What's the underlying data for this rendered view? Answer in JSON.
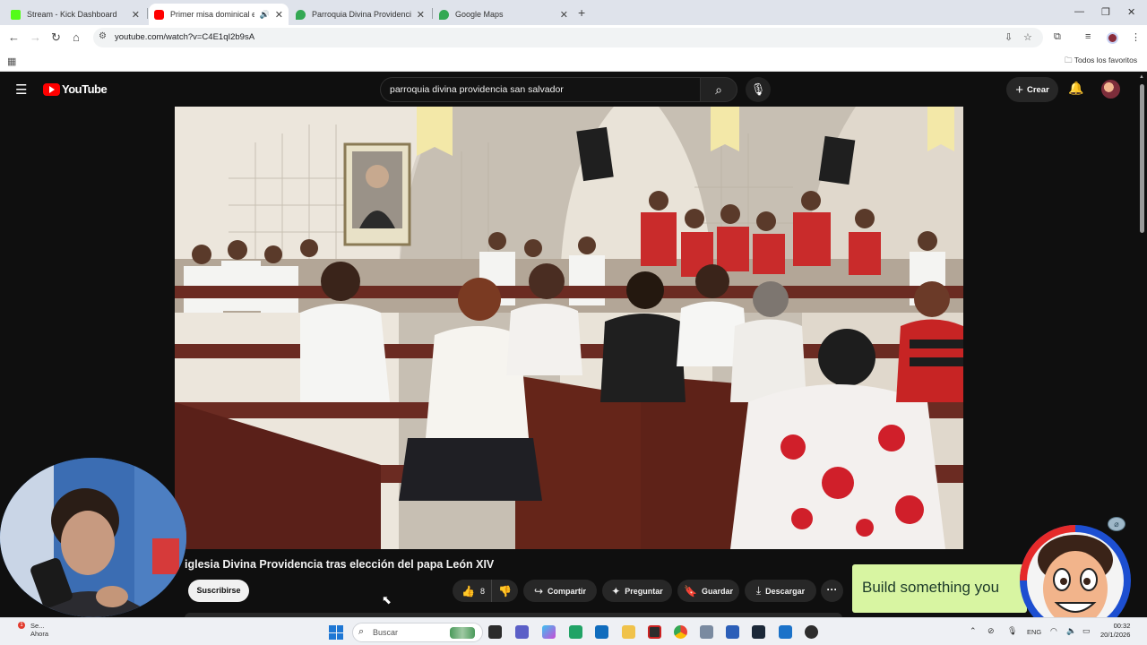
{
  "browser": {
    "tabs": [
      {
        "title": "Stream - Kick Dashboard",
        "favicon_color": "#53fc18"
      },
      {
        "title": "Primer misa dominical en iglesia Divina Providencia",
        "favicon_color": "#ff0000"
      },
      {
        "title": "Parroquia Divina Providencia - Google Maps",
        "favicon_color": "#34a853"
      },
      {
        "title": "Google Maps",
        "favicon_color": "#34a853"
      }
    ],
    "url": "youtube.com/watch?v=C4E1qI2b9sA",
    "bookmarks_all_label": "Todos los favoritos"
  },
  "youtube": {
    "logo_text": "YouTube",
    "search_query": "parroquia divina providencia san salvador",
    "create_label": "Crear"
  },
  "video": {
    "title": "iglesia Divina Providencia tras elección del papa León XIV",
    "subscribe_label": "Suscribirse",
    "like_count": "8",
    "actions": {
      "share": "Compartir",
      "ask": "Preguntar",
      "save": "Guardar",
      "download": "Descargar"
    }
  },
  "ad": {
    "text": "Build something you"
  },
  "taskbar": {
    "weather_line1": "Se...",
    "weather_line2": "Ahora",
    "search_label": "Buscar",
    "language": "ENG",
    "time": "00:32",
    "date": "20/1/2026"
  },
  "colors": {
    "youtube_red": "#ff0000",
    "youtube_dark": "#0f0f0f",
    "chrome_tabstrip": "#dfe3eb",
    "ad_background": "#d8f5a2"
  },
  "icons": [
    "apps-grid-icon",
    "back-icon",
    "forward-icon",
    "reload-icon",
    "home-icon",
    "tune-icon",
    "install-icon",
    "star-icon",
    "extensions-icon",
    "menu-icon",
    "search-icon",
    "mic-icon",
    "plus-icon",
    "bell-icon",
    "like-icon",
    "dislike-icon",
    "share-icon",
    "sparkle-icon",
    "bookmark-icon",
    "download-icon",
    "more-icon",
    "windows-start-icon"
  ]
}
